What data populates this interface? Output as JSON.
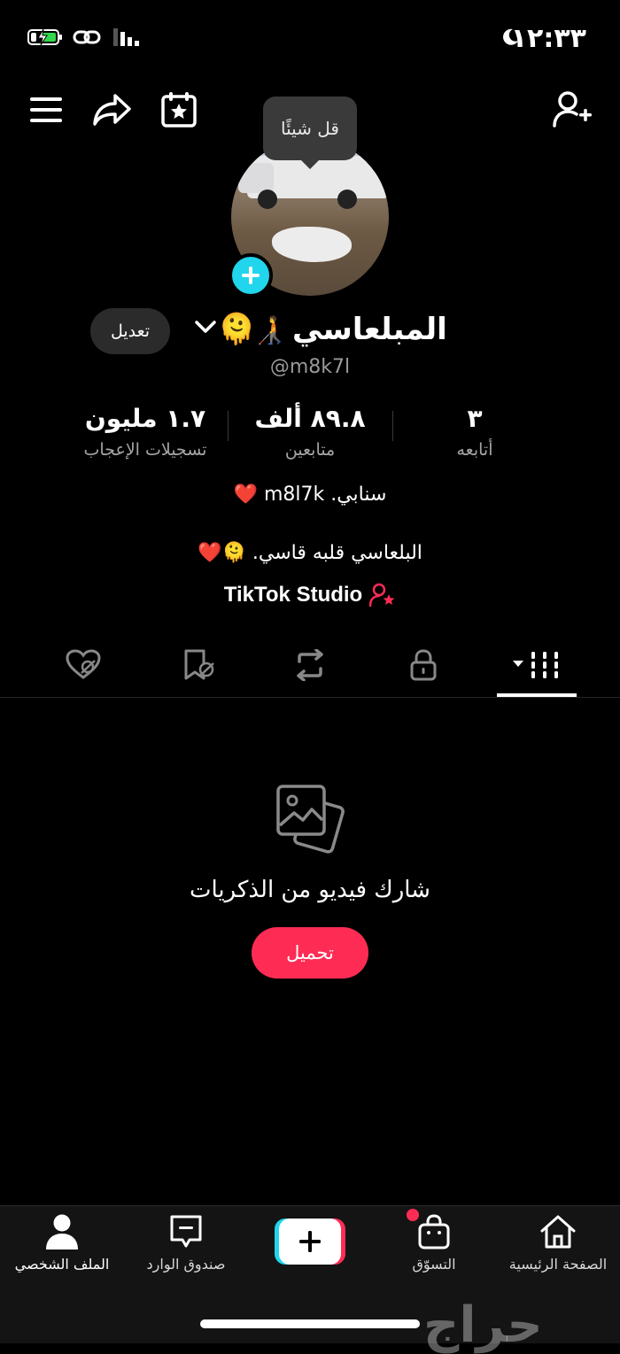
{
  "status_bar": {
    "time": "١٢:٣٣"
  },
  "tooltip": {
    "text": "قل شيئًا"
  },
  "profile": {
    "edit_label": "تعديل",
    "display_name": "المبلعاسي",
    "walker_emoji": "🧑‍🦯",
    "face_emoji": "🫠",
    "handle": "@m8k7l"
  },
  "stats": {
    "likes": {
      "value": "١.٧ مليون",
      "label": "تسجيلات الإعجاب"
    },
    "followers": {
      "value": "٨٩.٨ ألف",
      "label": "متابعين"
    },
    "following": {
      "value": "٣",
      "label": "أتابعه"
    }
  },
  "bio": {
    "line1": "سنابي. m8l7k ❤️",
    "line2": "البلعاسي قلبه قاسي. 🫠❤️",
    "studio": "TikTok Studio"
  },
  "empty_state": {
    "title": "شارك فيديو من الذكريات",
    "button": "تحميل"
  },
  "nav": {
    "profile": "الملف الشخصي",
    "inbox": "صندوق الوارد",
    "shop": "التسوّق",
    "home": "الصفحة الرئيسية"
  },
  "watermark": "حراج",
  "colors": {
    "accent": "#fe2c55",
    "cyan": "#20d5ec",
    "background": "#000000"
  }
}
